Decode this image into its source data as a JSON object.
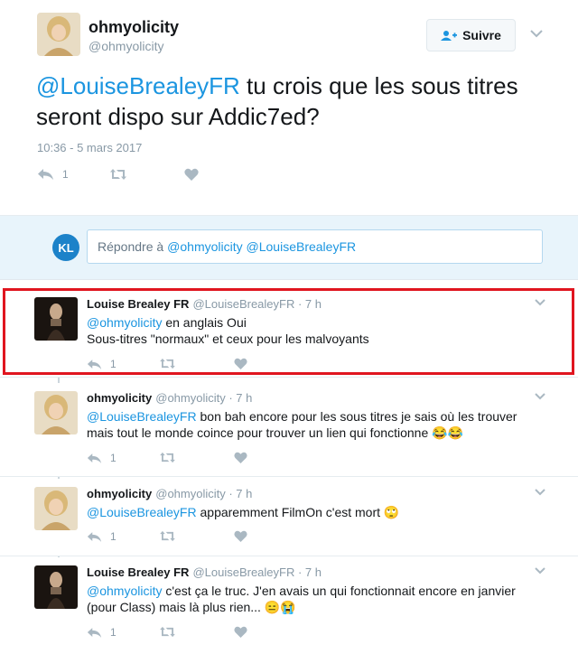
{
  "main_tweet": {
    "name": "ohmyolicity",
    "handle": "@ohmyolicity",
    "follow_label": "Suivre",
    "mention": "@LouiseBrealeyFR",
    "text": " tu crois que les sous titres seront dispo sur Addic7ed?",
    "timestamp": "10:36 - 5 mars 2017",
    "reply_count": "1"
  },
  "reply_box": {
    "avatar_initials": "KL",
    "prompt": "Répondre à",
    "mentions": "@ohmyolicity @LouiseBrealeyFR"
  },
  "replies": [
    {
      "name": "Louise Brealey FR",
      "handle": "@LouiseBrealeyFR · 7 h",
      "mention": "@ohmyolicity",
      "line1": " en anglais Oui",
      "line2": "Sous-titres \"normaux\" et ceux pour les malvoyants",
      "reply_count": "1"
    },
    {
      "name": "ohmyolicity",
      "handle": "@ohmyolicity · 7 h",
      "mention": "@LouiseBrealeyFR",
      "line1": " bon bah encore pour les sous titres je sais où les trouver",
      "line2": "mais tout le monde coince pour trouver un lien qui fonctionne 😂😂",
      "reply_count": "1"
    },
    {
      "name": "ohmyolicity",
      "handle": "@ohmyolicity · 7 h",
      "mention": "@LouiseBrealeyFR",
      "line1": " apparemment FilmOn c'est mort 🙄",
      "reply_count": "1"
    },
    {
      "name": "Louise Brealey FR",
      "handle": "@LouiseBrealeyFR · 7 h",
      "mention": "@ohmyolicity",
      "line1": " c'est ça le truc. J'en avais un qui fonctionnait encore en janvier",
      "line2": "(pour Class) mais là plus rien... 😑😭",
      "reply_count": "1"
    }
  ],
  "colors": {
    "link": "#1b95e0",
    "muted": "#8899a6",
    "reply_bg": "#e8f4fb",
    "highlight": "#e0151f"
  }
}
